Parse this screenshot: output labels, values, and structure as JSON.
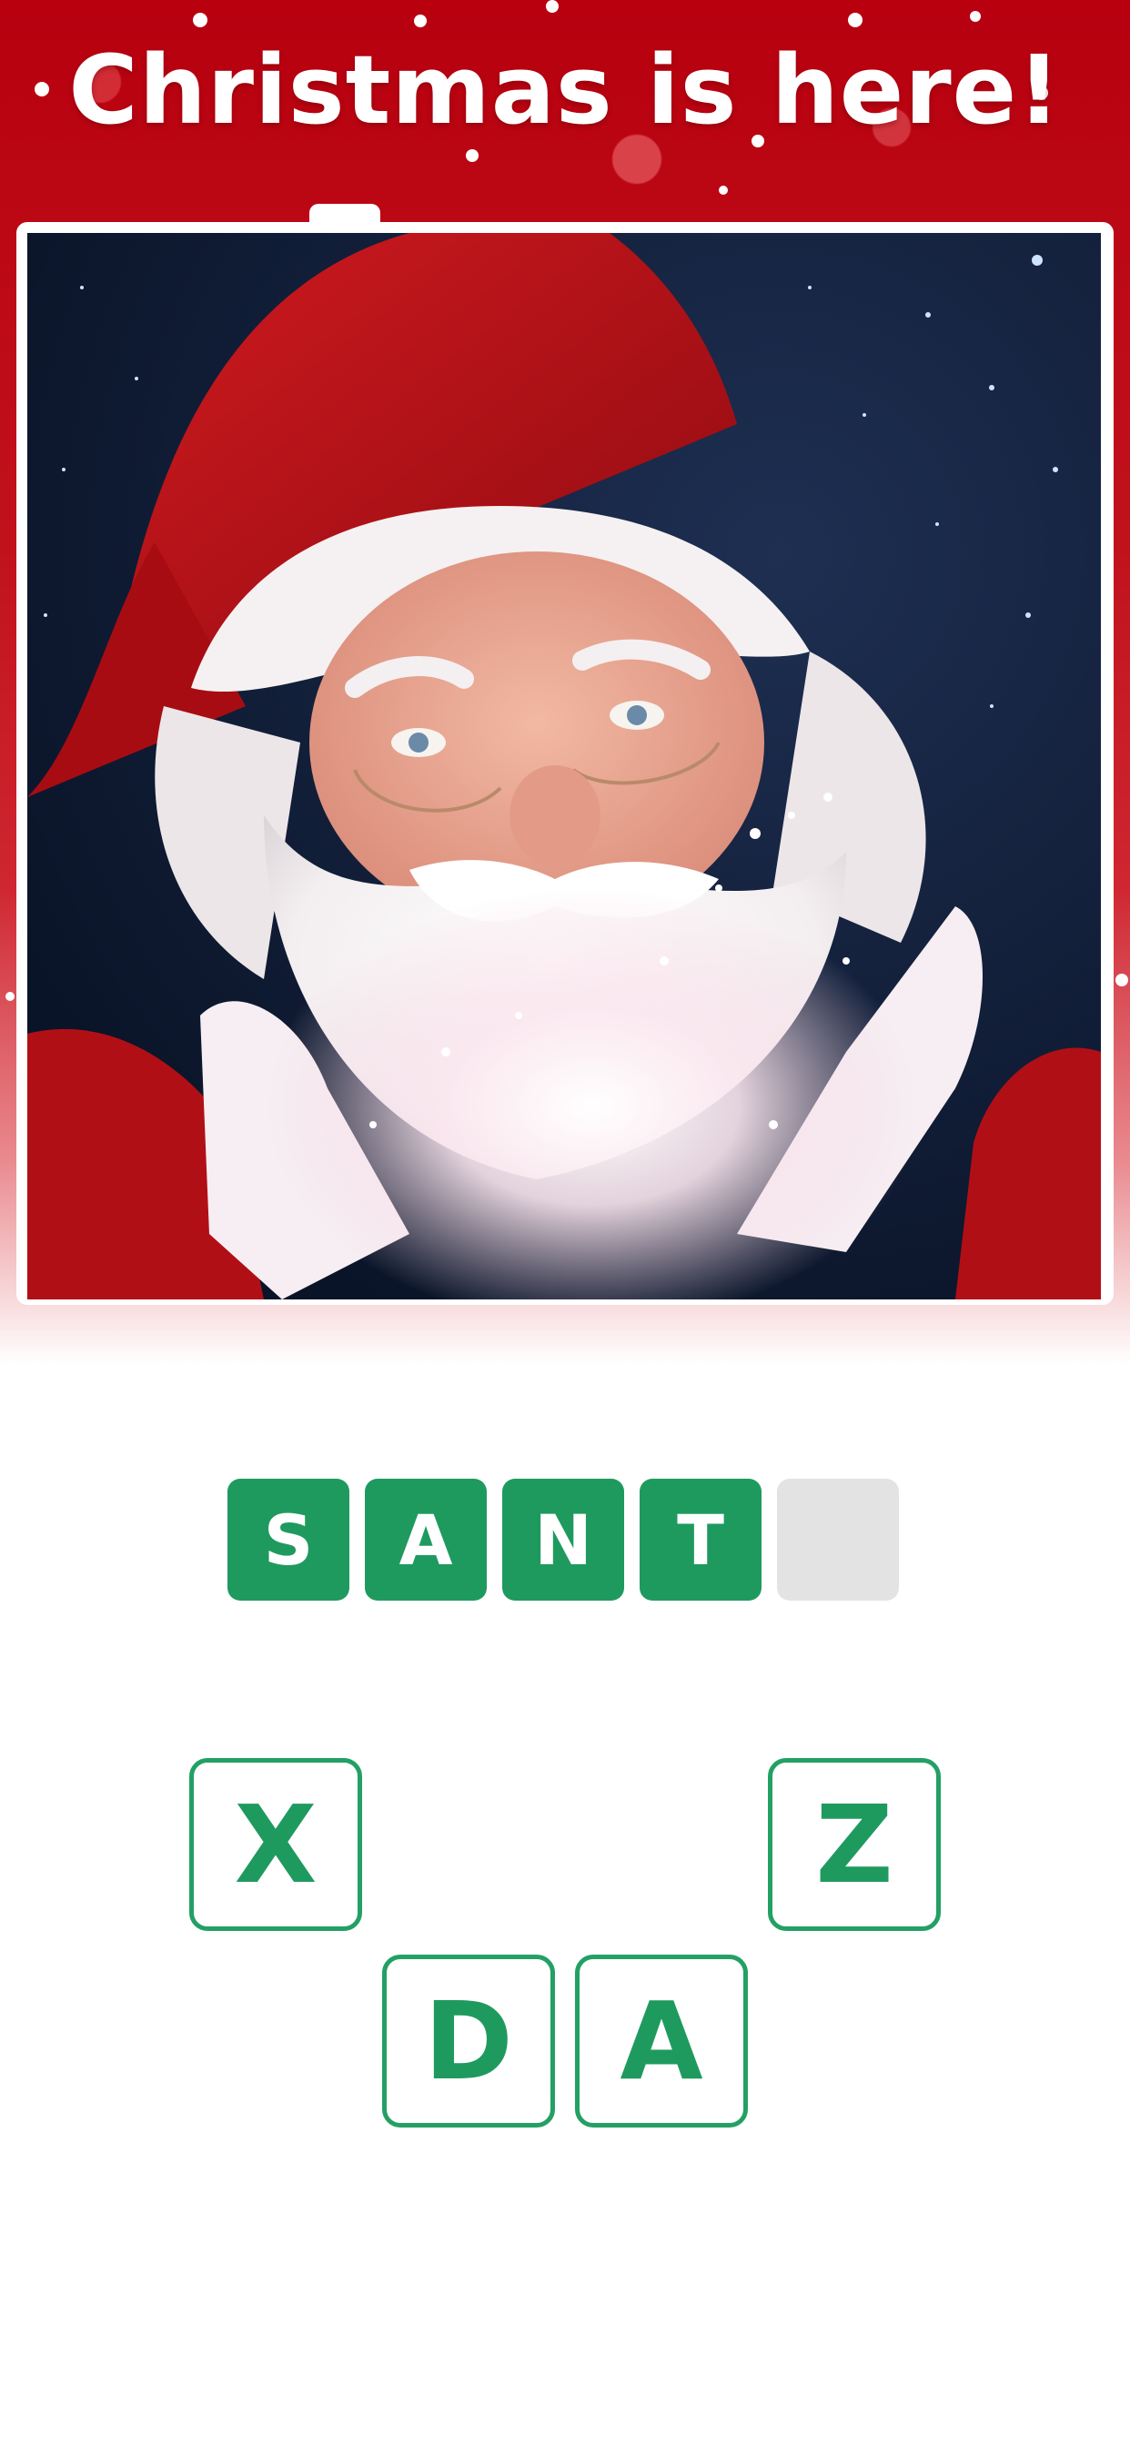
{
  "header": {
    "title": "Christmas is here!"
  },
  "puzzle": {
    "image_subject": "Santa Claus",
    "answer_slots": [
      {
        "letter": "S",
        "filled": true
      },
      {
        "letter": "A",
        "filled": true
      },
      {
        "letter": "N",
        "filled": true
      },
      {
        "letter": "T",
        "filled": true
      },
      {
        "letter": "",
        "filled": false
      }
    ]
  },
  "letter_tiles": [
    {
      "letter": "X"
    },
    {
      "letter": "Z"
    },
    {
      "letter": "D"
    },
    {
      "letter": "A"
    }
  ],
  "colors": {
    "header_red": "#c1121c",
    "tile_green": "#1f9a5f",
    "empty_slot_gray": "#e3e3e3"
  }
}
